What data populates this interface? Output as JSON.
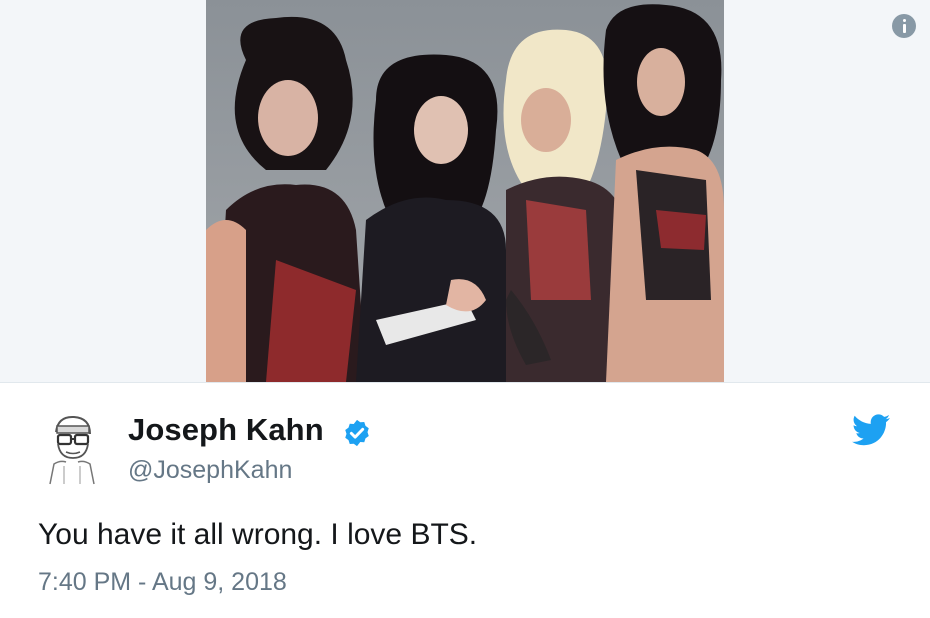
{
  "media": {
    "photo_alt": "",
    "background_color": "#f3f6f9",
    "info_icon": "info-icon"
  },
  "tweet": {
    "author_name": "Joseph Kahn",
    "author_handle": "@JosephKahn",
    "verified": true,
    "text": "You have it all wrong. I love BTS.",
    "timestamp": "7:40 PM - Aug 9, 2018"
  },
  "icons": {
    "verified": "verified-badge-icon",
    "brand": "twitter-bird-icon",
    "avatar": "avatar-sketch"
  },
  "colors": {
    "name": "#14171a",
    "secondary": "#657786",
    "verified_blue": "#1da1f2",
    "twitter_blue": "#1da1f2",
    "divider": "#e1e8ed",
    "info_icon": "#8899a6"
  }
}
